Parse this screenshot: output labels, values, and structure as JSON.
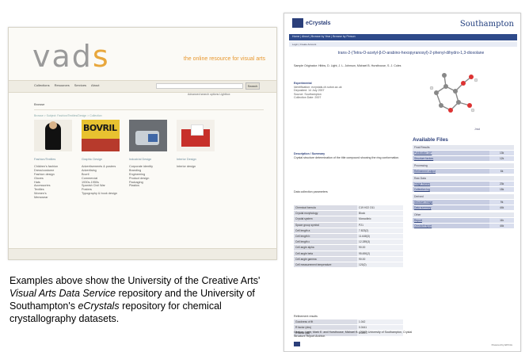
{
  "vads": {
    "logo_main": "vad",
    "logo_end": "s",
    "tagline": "the online resource for visual arts",
    "nav": [
      "Collections",
      "Resources",
      "Services",
      "About"
    ],
    "search_button": "Search",
    "advanced": "Advanced search options   Lightbox",
    "browse": "Browse",
    "crumb": "Browse > Subject: Fashion/Textiles/Design > Collection",
    "columns": [
      {
        "head": "Fashion/Textiles",
        "items": [
          "Children's fashion",
          "Dress/costume",
          "Fashion design",
          "Gloves",
          "Hats",
          "Accessories",
          "Textiles",
          "Women's",
          "Menswear"
        ]
      },
      {
        "head": "Graphic Design",
        "items": [
          "Advertisements & posters",
          "Advertising",
          "Bovril",
          "Commercial",
          "1930s-1950s",
          "Spanish Civil War",
          "Posters",
          "Typography & book design"
        ]
      },
      {
        "head": "Industrial Design",
        "items": [
          "Corporate identity",
          "Branding",
          "Engineering",
          "Product design",
          "Packaging",
          "Plastics"
        ]
      },
      {
        "head": "Interior Design",
        "items": [
          "Interior design"
        ]
      }
    ]
  },
  "caption": {
    "line1": "Examples above show the University of the Creative Arts'",
    "vads_name": "Visual Arts Data Service",
    "line2": "repository and the University of Southampton's",
    "ecry_name": "eCrystals",
    "line3": "repository for chemical crystallography datasets."
  },
  "ecrystals": {
    "brand": "eCrystals",
    "university": "Southampton",
    "nav_text": "Home | About | Browse by Year | Browse by Person",
    "sub_text": "Login | Create Account",
    "title": "trans-2-(Tetra-O-acetyl-β-D-arabino-hexopyranosyl)-2-phenyl-dihydro-1,3-dioxolane",
    "authors": "Sample Originator: Hibbs, D. Light, J. L. Johnson, Michael B. Hursthouse, S. J. Coles",
    "abstract_head": "Experimental",
    "identifiers": "Identification: ecrystals.ch.soton.ac.uk",
    "meta": [
      "Deposited: 14 July 2007",
      "Source: Southampton",
      "Collection Date: 2007"
    ],
    "description_head": "Description / Summary",
    "description": "Crystal structure determination of the title compound showing the ring conformation.",
    "datainfo_head": "Data collection parameters",
    "table_rows": [
      [
        "Chemical formula",
        "C19 H22 O11"
      ],
      [
        "Crystal morphology",
        "Block"
      ],
      [
        "Crystal system",
        "Monoclinic"
      ],
      [
        "Space group symbol",
        "P21"
      ],
      [
        "Cell length a",
        "7.823(2)"
      ],
      [
        "Cell length b",
        "11.648(3)"
      ],
      [
        "Cell length c",
        "12.289(3)"
      ],
      [
        "Cell angle alpha",
        "90.00"
      ],
      [
        "Cell angle beta",
        "95.690(2)"
      ],
      [
        "Cell angle gamma",
        "90.00"
      ],
      [
        "Cell measurement temperature",
        "120(2)"
      ]
    ],
    "refinement_head": "Refinement results",
    "refinement_rows": [
      [
        "Goodness of fit",
        "1.042"
      ],
      [
        "R factor (obs)",
        "0.0441"
      ],
      [
        "R factor (all)",
        "0.0497"
      ],
      [
        "Weighted R factor (obs)",
        "0.1085"
      ],
      [
        "Weighted R factor (all)",
        "0.1127"
      ]
    ],
    "citation": "Citation: Light, Mark E. and Hursthouse, Michael B. (2007) University of Southampton, Crystal Structure Report Archive.",
    "files_title": "Available Files",
    "file_groups": [
      {
        "head": "Final Results",
        "files": [
          [
            "Publication CIF",
            "13k"
          ],
          [
            "Structure factors",
            "12k"
          ]
        ]
      },
      {
        "head": "Processing",
        "files": [
          [
            "Refinement output",
            "6k"
          ]
        ]
      },
      {
        "head": "Raw Data",
        "files": [
          [
            "Image frames",
            "23k"
          ],
          [
            "Collection log",
            "15k"
          ]
        ]
      },
      {
        "head": "Derived",
        "files": [
          [
            "Structure image",
            "9k"
          ],
          [
            "Data summary",
            "44k"
          ]
        ]
      },
      {
        "head": "Other",
        "files": [
          [
            "Report",
            "11k"
          ],
          [
            "Checkcif report",
            "44k"
          ]
        ]
      }
    ],
    "jmol": "Jmol",
    "footer": "Powered by EPrints"
  }
}
